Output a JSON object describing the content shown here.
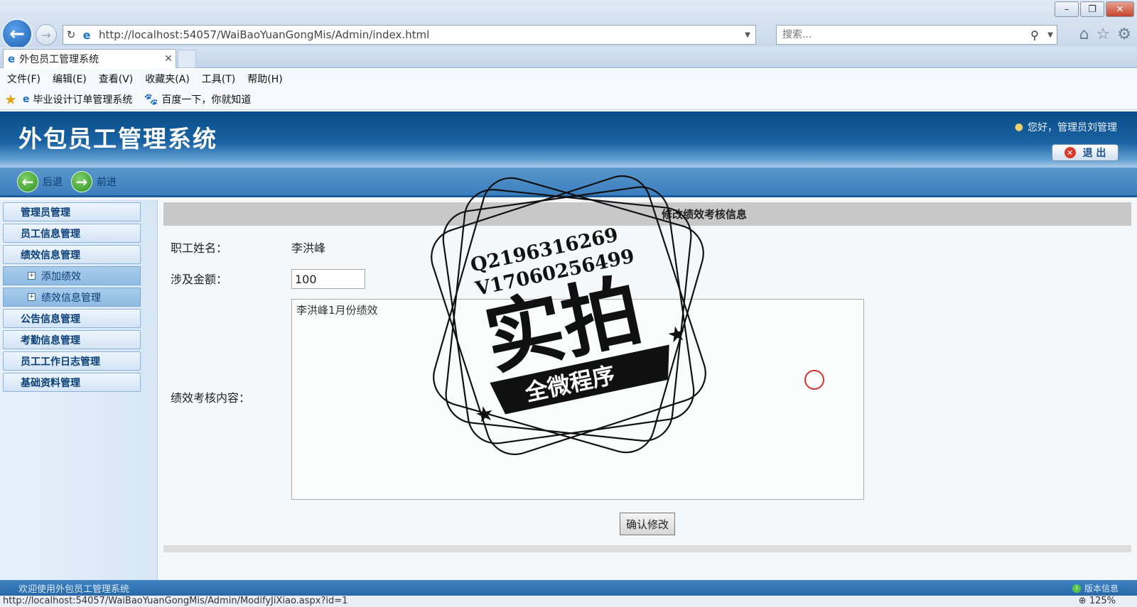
{
  "browser": {
    "address": "http://localhost:54057/WaiBaoYuanGongMis/Admin/index.html",
    "search_placeholder": "搜索...",
    "tab_title": "外包员工管理系统",
    "menu": [
      "文件(F)",
      "编辑(E)",
      "查看(V)",
      "收藏夹(A)",
      "工具(T)",
      "帮助(H)"
    ],
    "favorites": [
      "毕业设计订单管理系统",
      "百度一下，你就知道"
    ],
    "status_url": "http://localhost:54057/WaiBaoYuanGongMis/Admin/ModifyJiXiao.aspx?id=1",
    "zoom": "125%"
  },
  "app": {
    "title": "外包员工管理系统",
    "greeting": "您好，管理员刘管理",
    "logout_label": "退 出",
    "nav": {
      "back": "后退",
      "forward": "前进"
    },
    "sidebar": {
      "items": [
        "管理员管理",
        "员工信息管理",
        "绩效信息管理"
      ],
      "sub_items": [
        "添加绩效",
        "绩效信息管理"
      ],
      "items_after": [
        "公告信息管理",
        "考勤信息管理",
        "员工工作日志管理",
        "基础资料管理"
      ]
    },
    "form": {
      "heading": "修改绩效考核信息",
      "name_label": "职工姓名：",
      "name_value": "李洪峰",
      "amount_label": "涉及金额：",
      "amount_value": "100",
      "content_label": "绩效考核内容：",
      "content_value": "李洪峰1月份绩效",
      "submit_label": "确认修改"
    },
    "footer": {
      "welcome": "欢迎使用外包员工管理系统",
      "version": "版本信息"
    }
  },
  "watermark": {
    "qq": "Q2196316269",
    "wechat": "V17060256499",
    "main": "实拍",
    "banner": "全微程序"
  }
}
